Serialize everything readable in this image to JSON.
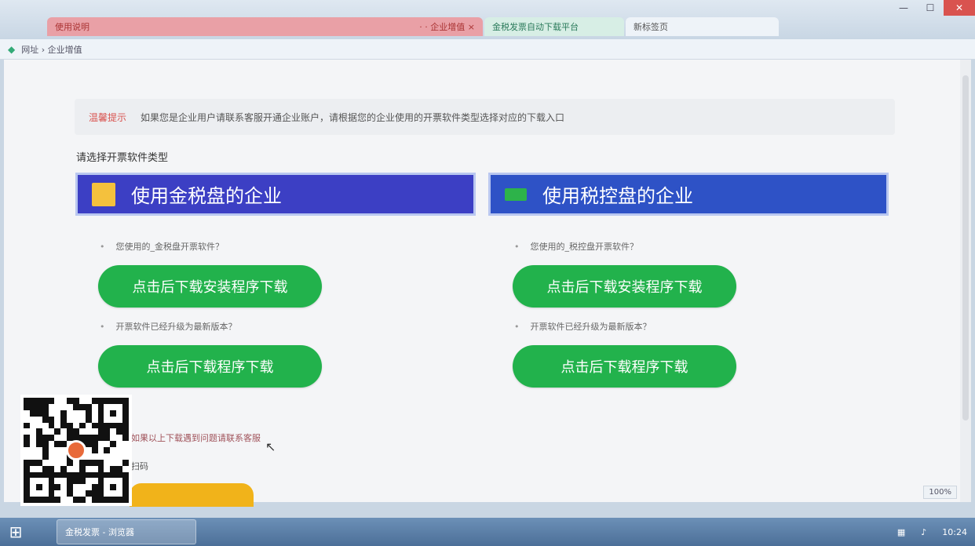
{
  "browser": {
    "tabs": [
      {
        "label": "使用说明",
        "extra": "·  ·  企业增值 ×"
      },
      {
        "label": "金税发票自动下载平台"
      },
      {
        "label": "新标签页"
      }
    ],
    "address": "网址  ›  企业增值"
  },
  "notice": {
    "label": "温馨提示",
    "text": "如果您是企业用户请联系客服开通企业账户，请根据您的企业使用的开票软件类型选择对应的下载入口"
  },
  "section_title": "请选择开票软件类型",
  "banners": {
    "left": "使用金税盘的企业",
    "right": "使用税控盘的企业"
  },
  "left_col": {
    "q1": "您使用的_金税盘开票软件？",
    "btn1": "点击后下载安装程序下载",
    "q2": "开票软件已经升级为最新版本？",
    "btn2": "点击后下载程序下载"
  },
  "right_col": {
    "q1": "您使用的_税控盘开票软件？",
    "btn1": "点击后下载安装程序下载",
    "q2": "开票软件已经升级为最新版本？",
    "btn2": "点击后下载程序下载"
  },
  "footnote": "如果以上下载遇到问题请联系客服",
  "footnote2": "扫码",
  "zoom": "100%",
  "taskbar": {
    "item": "金税发票 - 浏览器",
    "tray_time": "10:24"
  },
  "colors": {
    "banner_left": "#3c3fc4",
    "banner_right": "#2e52c6",
    "green_button": "#22b24c",
    "notice_label": "#d9534f"
  }
}
